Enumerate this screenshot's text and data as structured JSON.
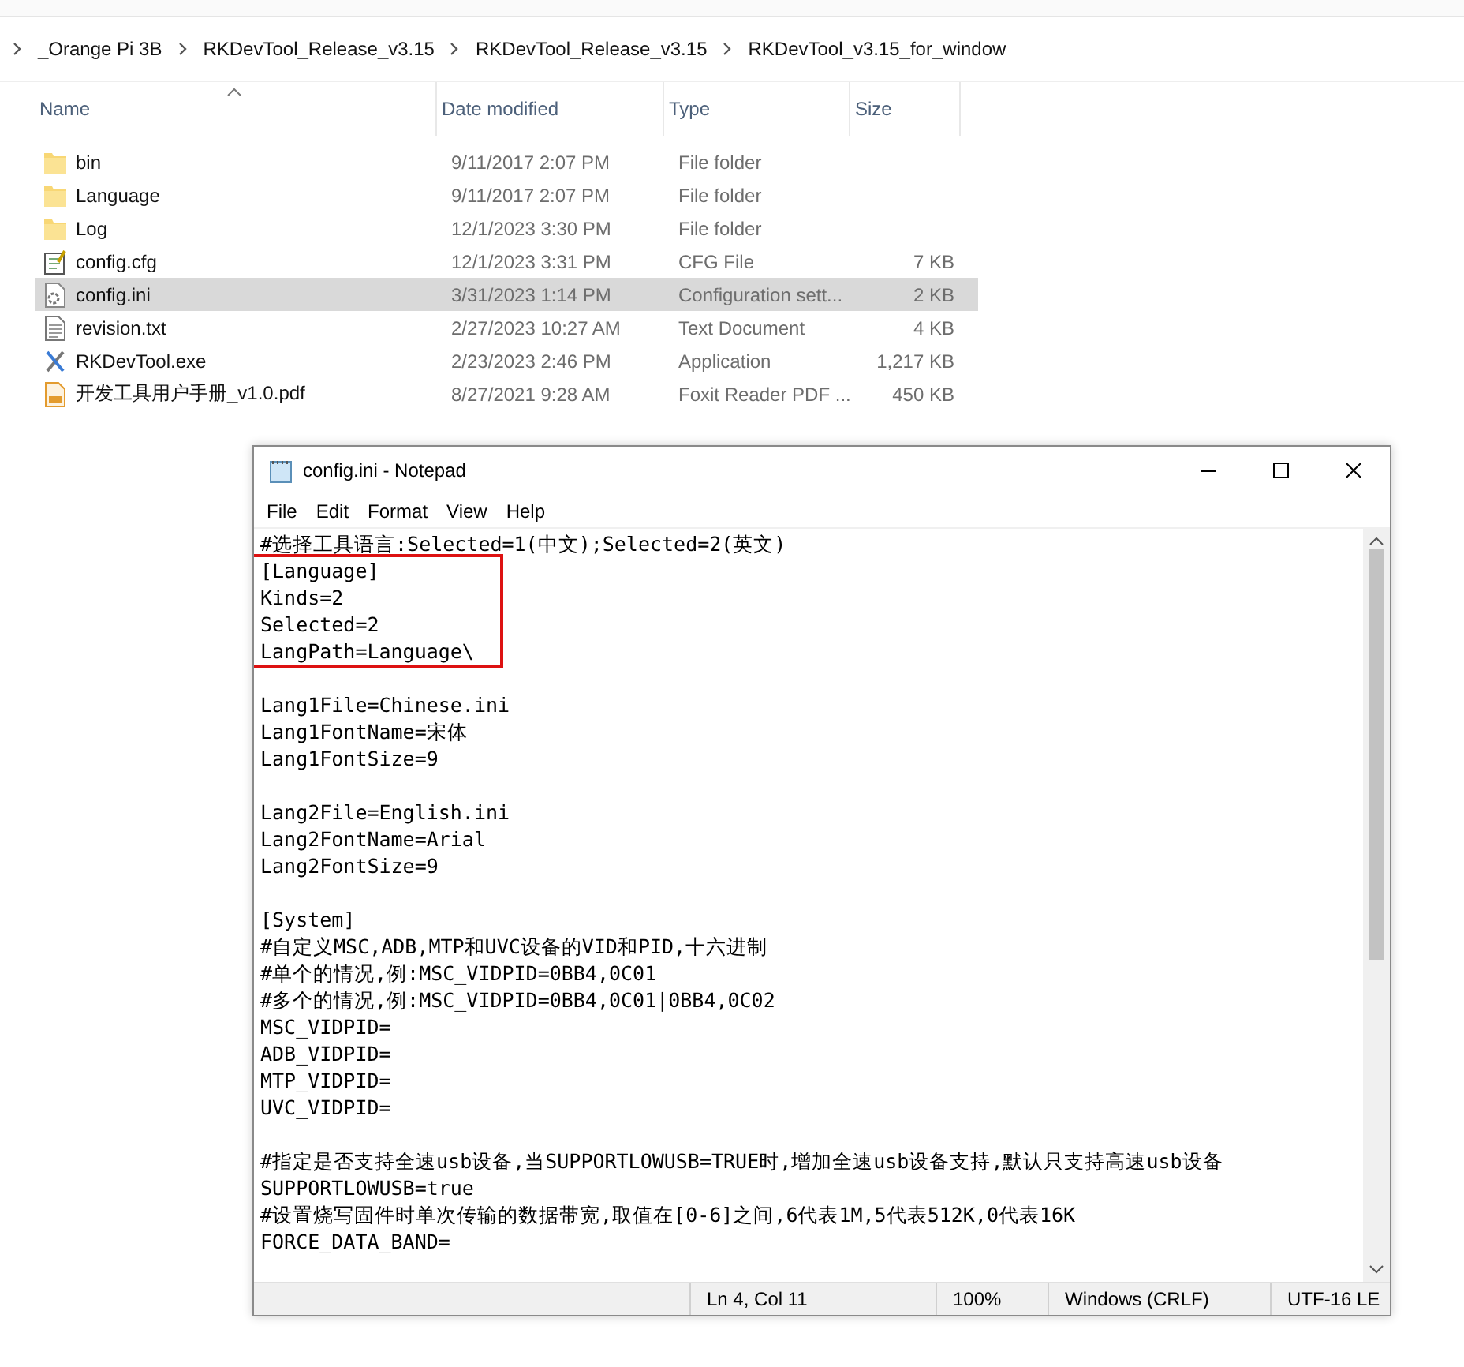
{
  "explorer": {
    "breadcrumb": [
      "_Orange Pi 3B",
      "RKDevTool_Release_v3.15",
      "RKDevTool_Release_v3.15",
      "RKDevTool_v3.15_for_window"
    ],
    "columns": [
      {
        "label": "Name",
        "sorted": true
      },
      {
        "label": "Date modified",
        "sorted": false
      },
      {
        "label": "Type",
        "sorted": false
      },
      {
        "label": "Size",
        "sorted": false
      }
    ],
    "files": [
      {
        "kind": "folder",
        "name": "bin",
        "date": "9/11/2017 2:07 PM",
        "type": "File folder",
        "selected": false
      },
      {
        "kind": "folder",
        "name": "Language",
        "date": "9/11/2017 2:07 PM",
        "type": "File folder",
        "selected": false
      },
      {
        "kind": "folder",
        "name": "Log",
        "date": "12/1/2023 3:30 PM",
        "type": "File folder",
        "selected": false
      },
      {
        "kind": "cfg",
        "name": "config.cfg",
        "date": "12/1/2023 3:31 PM",
        "type": "CFG File",
        "size": "7 KB",
        "selected": false
      },
      {
        "kind": "ini",
        "name": "config.ini",
        "date": "3/31/2023 1:14 PM",
        "type": "Configuration sett...",
        "size": "2 KB",
        "selected": true
      },
      {
        "kind": "txt",
        "name": "revision.txt",
        "date": "2/27/2023 10:27 AM",
        "type": "Text Document",
        "size": "4 KB",
        "selected": false
      },
      {
        "kind": "exe",
        "name": "RKDevTool.exe",
        "date": "2/23/2023 2:46 PM",
        "type": "Application",
        "size": "1,217 KB",
        "selected": false
      },
      {
        "kind": "pdf",
        "name": "开发工具用户手册_v1.0.pdf",
        "date": "8/27/2021 9:28 AM",
        "type": "Foxit Reader PDF ...",
        "size": "450 KB",
        "selected": false
      }
    ]
  },
  "notepad": {
    "title": "config.ini - Notepad",
    "menu": [
      "File",
      "Edit",
      "Format",
      "View",
      "Help"
    ],
    "lines": [
      {
        "kind": "text",
        "text": "#选择工具语言:Selected=1(中文);Selected=2(英文)",
        "highlighted": false
      },
      {
        "kind": "text",
        "text": "[Language]",
        "highlighted": true
      },
      {
        "kind": "text",
        "text": "Kinds=2",
        "highlighted": true
      },
      {
        "kind": "text",
        "text": "Selected=2",
        "highlighted": true
      },
      {
        "kind": "text",
        "text": "LangPath=Language\\",
        "highlighted": true
      },
      {
        "kind": "blank",
        "highlighted": false
      },
      {
        "kind": "text",
        "text": "Lang1File=Chinese.ini",
        "highlighted": false
      },
      {
        "kind": "text",
        "text": "Lang1FontName=宋体",
        "highlighted": false
      },
      {
        "kind": "text",
        "text": "Lang1FontSize=9",
        "highlighted": false
      },
      {
        "kind": "blank",
        "highlighted": false
      },
      {
        "kind": "text",
        "text": "Lang2File=English.ini",
        "highlighted": false
      },
      {
        "kind": "text",
        "text": "Lang2FontName=Arial",
        "highlighted": false
      },
      {
        "kind": "text",
        "text": "Lang2FontSize=9",
        "highlighted": false
      },
      {
        "kind": "blank",
        "highlighted": false
      },
      {
        "kind": "text",
        "text": "[System]",
        "highlighted": false
      },
      {
        "kind": "text",
        "text": "#自定义MSC,ADB,MTP和UVC设备的VID和PID,十六进制",
        "highlighted": false
      },
      {
        "kind": "text",
        "text": "#单个的情况,例:MSC_VIDPID=0BB4,0C01",
        "highlighted": false
      },
      {
        "kind": "text",
        "text": "#多个的情况,例:MSC_VIDPID=0BB4,0C01|0BB4,0C02",
        "highlighted": false
      },
      {
        "kind": "text",
        "text": "MSC_VIDPID=",
        "highlighted": false
      },
      {
        "kind": "text",
        "text": "ADB_VIDPID=",
        "highlighted": false
      },
      {
        "kind": "text",
        "text": "MTP_VIDPID=",
        "highlighted": false
      },
      {
        "kind": "text",
        "text": "UVC_VIDPID=",
        "highlighted": false
      },
      {
        "kind": "blank",
        "highlighted": false
      },
      {
        "kind": "text",
        "text": "#指定是否支持全速usb设备,当SUPPORTLOWUSB=TRUE时,增加全速usb设备支持,默认只支持高速usb设备",
        "highlighted": false
      },
      {
        "kind": "text",
        "text": "SUPPORTLOWUSB=true",
        "highlighted": false
      },
      {
        "kind": "text",
        "text": "#设置烧写固件时单次传输的数据带宽,取值在[0-6]之间,6代表1M,5代表512K,0代表16K",
        "highlighted": false
      },
      {
        "kind": "text",
        "text": "FORCE_DATA_BAND=",
        "highlighted": false
      }
    ],
    "status": [
      "Ln 4, Col 11",
      "100%",
      "Windows (CRLF)",
      "UTF-16 LE"
    ]
  }
}
